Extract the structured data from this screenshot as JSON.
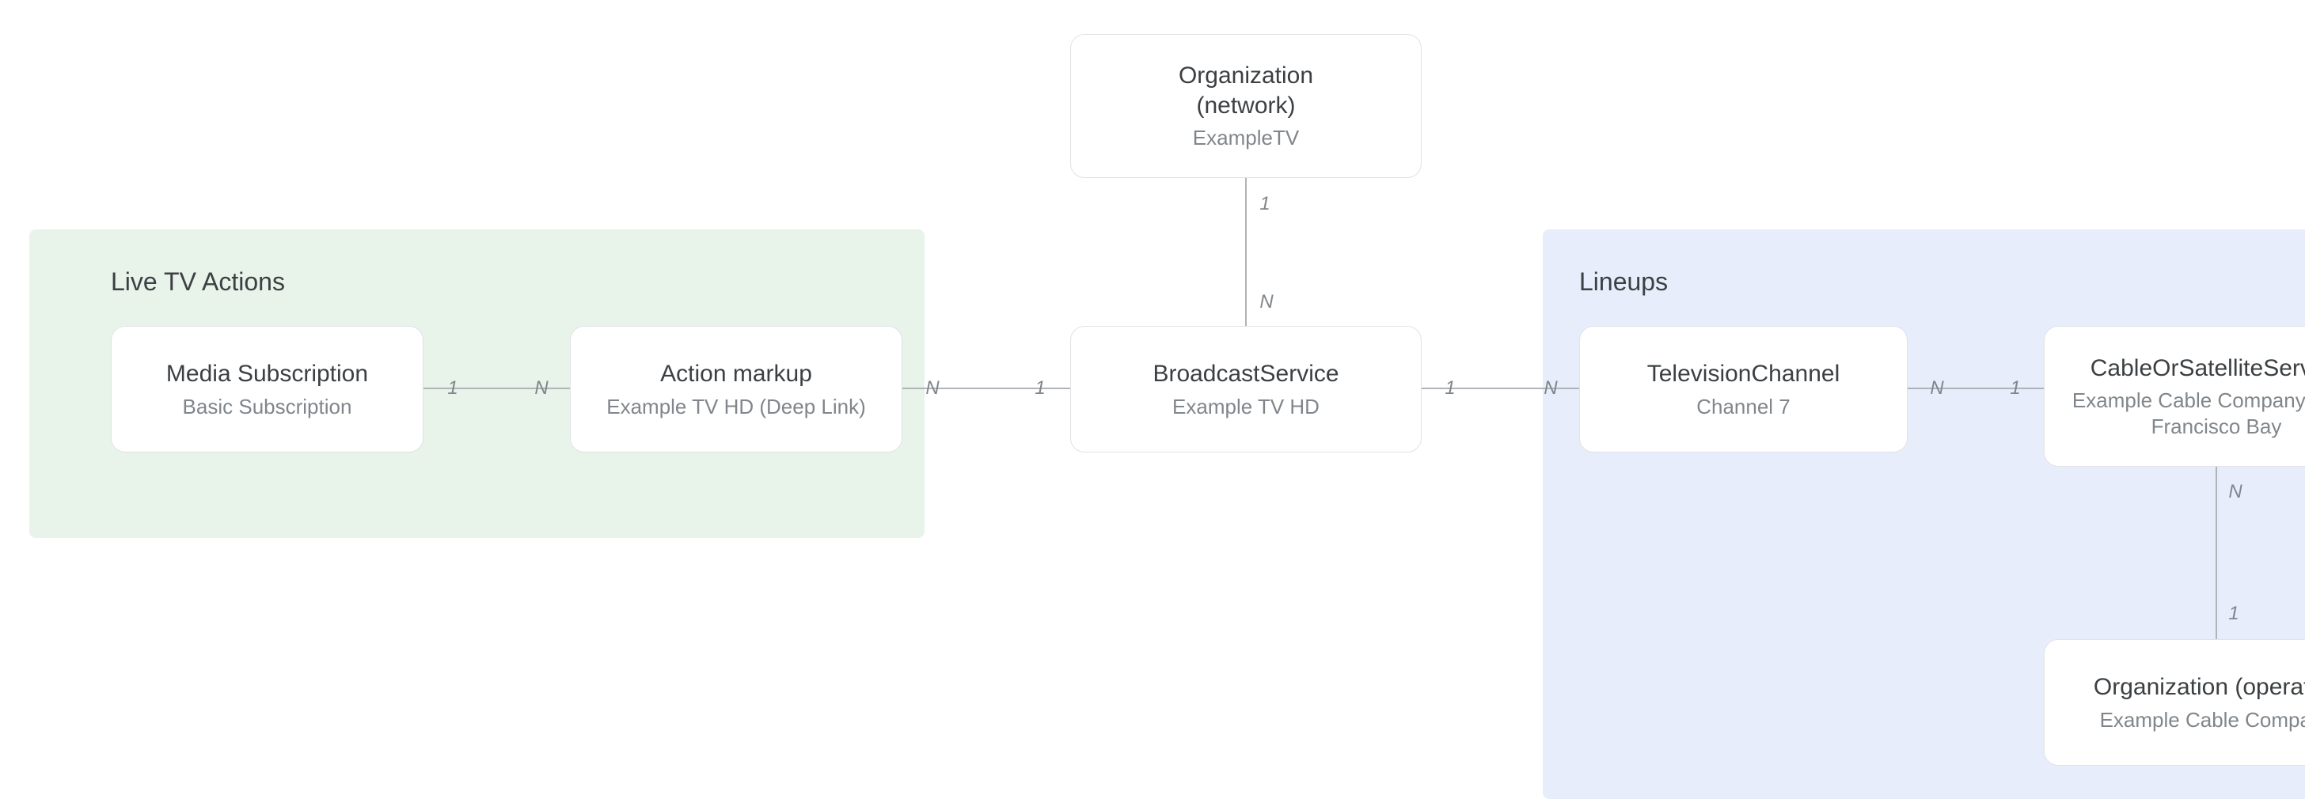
{
  "groups": {
    "live_tv_actions": {
      "title": "Live TV Actions"
    },
    "lineups": {
      "title": "Lineups"
    }
  },
  "nodes": {
    "organization_network": {
      "title": "Organization\n(network)",
      "subtitle": "ExampleTV"
    },
    "media_subscription": {
      "title": "Media Subscription",
      "subtitle": "Basic Subscription"
    },
    "action_markup": {
      "title": "Action markup",
      "subtitle": "Example TV HD (Deep Link)"
    },
    "broadcast_service": {
      "title": "BroadcastService",
      "subtitle": "Example TV HD"
    },
    "television_channel": {
      "title": "TelevisionChannel",
      "subtitle": "Channel 7"
    },
    "cable_or_satellite_service": {
      "title": "CableOrSatelliteService",
      "subtitle": "Example Cable Company - San Francisco Bay"
    },
    "organization_operator": {
      "title": "Organization (operator)",
      "subtitle": "Example Cable Company"
    }
  },
  "cardinalities": {
    "one": "1",
    "many": "N"
  }
}
